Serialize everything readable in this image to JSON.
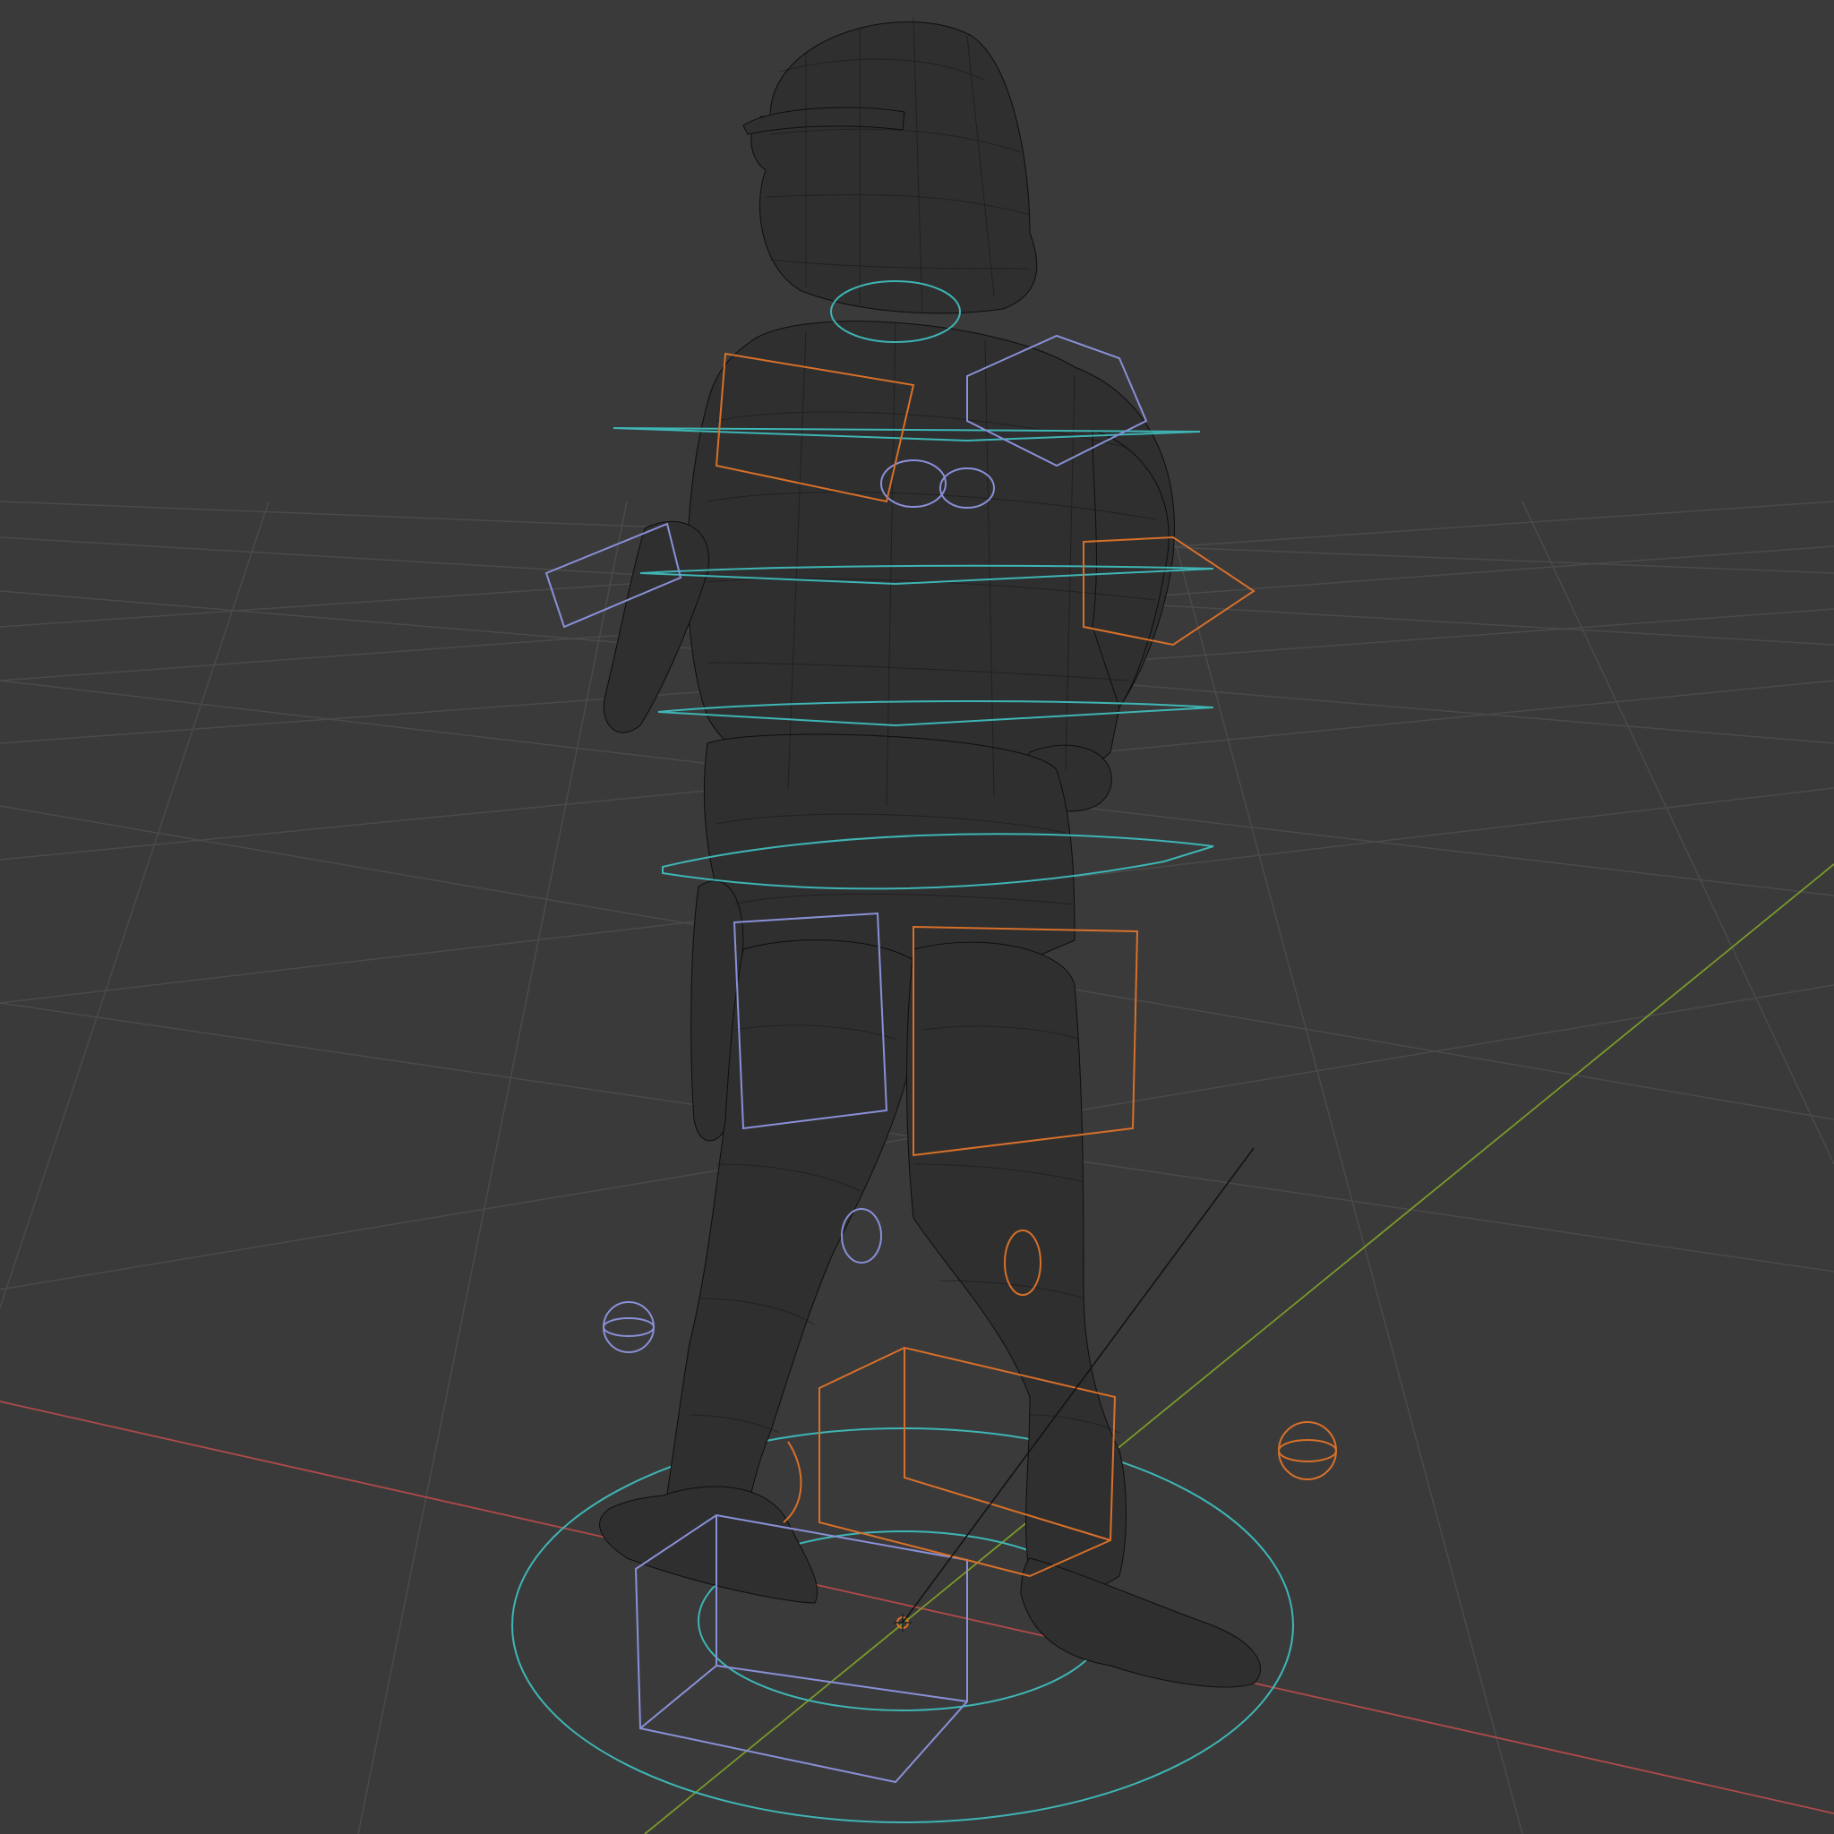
{
  "viewport": {
    "mode": "wireframe",
    "colors": {
      "background": "#3a3a3a",
      "grid": "#4a4a4a",
      "x_axis": "#b04a4a",
      "y_axis": "#7a9a2a",
      "mesh": "#111111",
      "fk_control": "#8a90d8",
      "ik_control": "#d8702a",
      "spine_control": "#3fb5b5"
    },
    "object": {
      "name_icon": "armature-character-icon",
      "type": "rigged-character-mesh"
    },
    "controls": [
      {
        "kind": "ring",
        "color_key": "spine_control",
        "icon": "spine-ring-icon"
      },
      {
        "kind": "cube",
        "color_key": "fk_control",
        "icon": "fk-cube-icon"
      },
      {
        "kind": "cube",
        "color_key": "ik_control",
        "icon": "ik-cube-icon"
      },
      {
        "kind": "sphere",
        "color_key": "fk_control",
        "icon": "pole-sphere-icon"
      },
      {
        "kind": "sphere",
        "color_key": "ik_control",
        "icon": "pole-sphere-icon"
      }
    ]
  }
}
